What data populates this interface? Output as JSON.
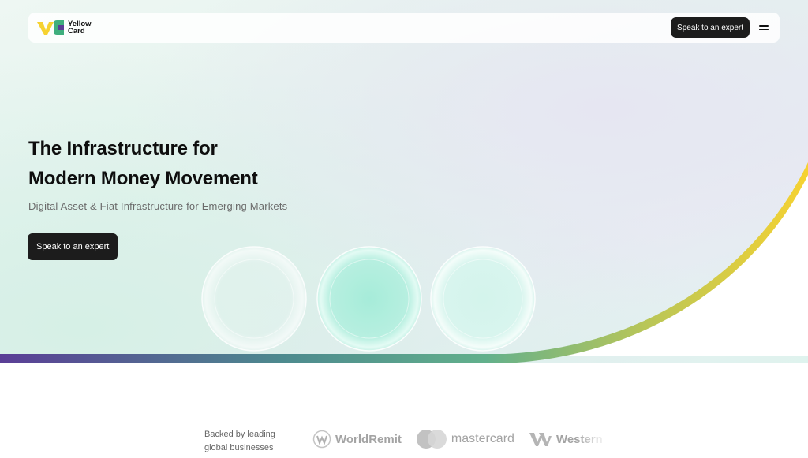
{
  "brand": {
    "name_line1": "Yellow",
    "name_line2": "Card"
  },
  "nav": {
    "cta_label": "Speak to an expert"
  },
  "hero": {
    "title_line1": "The Infrastructure for",
    "title_line2": "Modern Money Movement",
    "subtitle": "Digital Asset & Fiat Infrastructure for Emerging Markets",
    "cta_label": "Speak to an expert"
  },
  "partners": {
    "intro_line1": "Backed by leading",
    "intro_line2": "global businesses",
    "items": [
      {
        "name": "WorldRemit",
        "icon": "worldremit-logo-icon"
      },
      {
        "name": "mastercard",
        "icon": "mastercard-logo-icon"
      },
      {
        "name": "Western",
        "icon": "western-union-logo-icon"
      }
    ]
  },
  "colors": {
    "brand_yellow": "#f6d231",
    "brand_green": "#3fae7d",
    "brand_purple": "#5a3e96",
    "dark_button": "#1c1c1c"
  }
}
